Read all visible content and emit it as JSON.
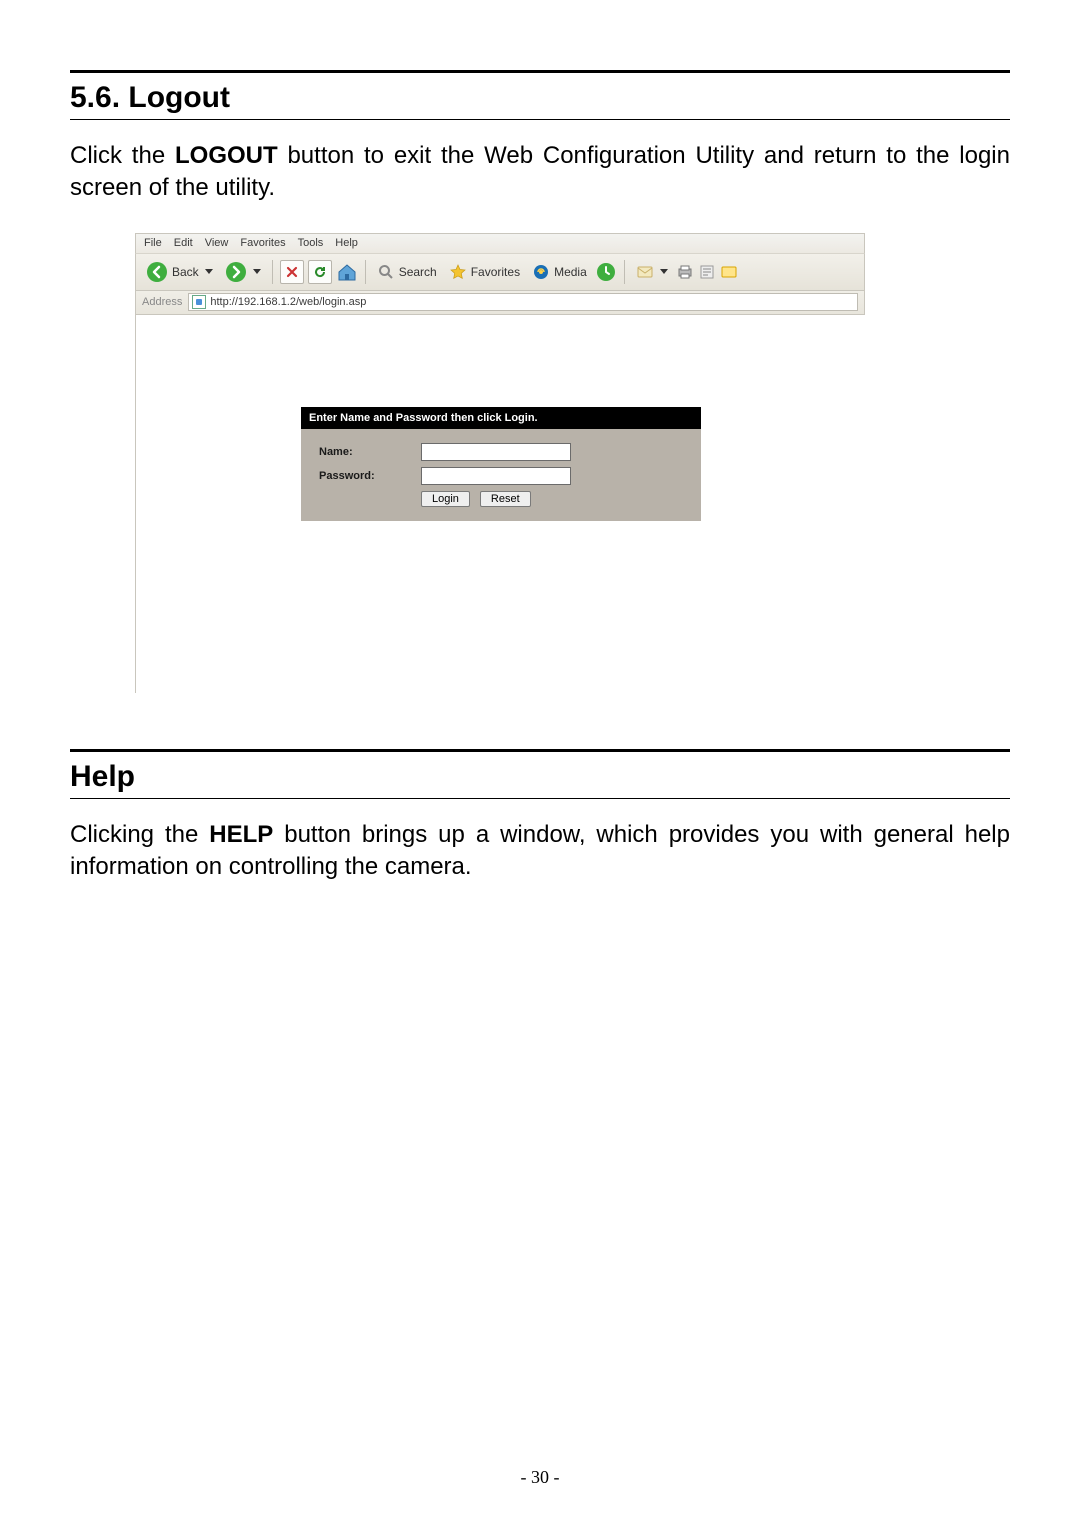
{
  "section_logout": {
    "heading": "5.6. Logout",
    "para_pre": "Click the ",
    "para_bold": "LOGOUT",
    "para_post": " button to exit the Web Configuration Utility and return to the login screen of the utility."
  },
  "section_help": {
    "heading": "Help",
    "para_pre": "Clicking the ",
    "para_bold": "HELP",
    "para_post": " button brings up a window, which provides you with general help information on controlling the camera."
  },
  "ie": {
    "menu": {
      "file": "File",
      "edit": "Edit",
      "view": "View",
      "favorites": "Favorites",
      "tools": "Tools",
      "help": "Help"
    },
    "toolbar": {
      "back": "Back",
      "search": "Search",
      "favorites": "Favorites",
      "media": "Media"
    },
    "address_label": "Address",
    "url": "http://192.168.1.2/web/login.asp"
  },
  "login": {
    "header": "Enter Name and Password then click Login.",
    "name_label": "Name:",
    "password_label": "Password:",
    "name_value": "",
    "password_value": "",
    "login_btn": "Login",
    "reset_btn": "Reset"
  },
  "page_number": "- 30 -"
}
